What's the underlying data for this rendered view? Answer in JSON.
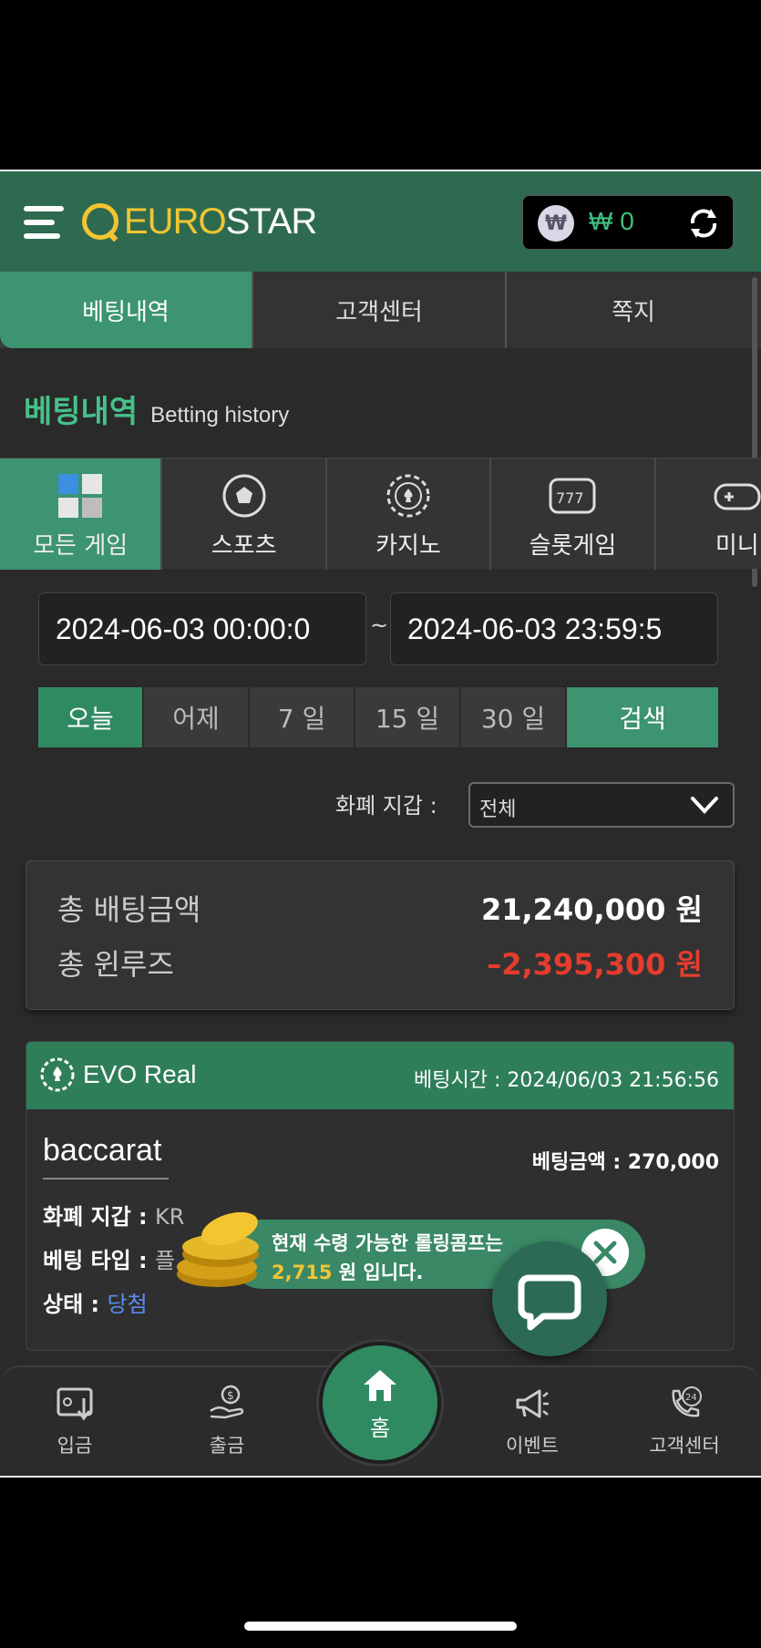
{
  "header": {
    "logo_euro": "EURO",
    "logo_star": "STAR",
    "won_symbol": "₩",
    "wallet_amount": "₩ 0"
  },
  "top_tabs": [
    {
      "label": "베팅내역",
      "active": true
    },
    {
      "label": "고객센터",
      "active": false
    },
    {
      "label": "쪽지",
      "active": false
    }
  ],
  "section": {
    "title_ko": "베팅내역",
    "title_en": "Betting history"
  },
  "categories": [
    {
      "label": "모든 게임",
      "icon": "all-games-icon",
      "active": true
    },
    {
      "label": "스포츠",
      "icon": "soccer-ball-icon",
      "active": false
    },
    {
      "label": "카지노",
      "icon": "casino-chip-icon",
      "active": false
    },
    {
      "label": "슬롯게임",
      "icon": "slot-machine-icon",
      "active": false
    },
    {
      "label": "미니",
      "icon": "gamepad-icon",
      "active": false
    }
  ],
  "filter": {
    "date_from": "2024-06-03 00:00:0",
    "date_to": "2024-06-03 23:59:5",
    "tilde": "~",
    "ranges": [
      "오늘",
      "어제",
      "7 일",
      "15 일",
      "30 일"
    ],
    "active_range": "오늘",
    "search_label": "검색",
    "currency_label": "화폐 지갑 :",
    "currency_value": "전체"
  },
  "summary": {
    "total_bet_label": "총 배팅금액",
    "total_bet_value": "21,240,000 원",
    "total_winloss_label": "총 윈루즈",
    "total_winloss_value": "–2,395,300 원"
  },
  "bet_card": {
    "game": "EVO Real",
    "bet_time": "베팅시간 : 2024/06/03 21:56:56",
    "title": "baccarat",
    "amount": "베팅금액 : 270,000",
    "currency_label": "화폐 지갑 :",
    "currency_value": "KR",
    "type_label": "베팅 타입 :",
    "type_value": "플",
    "status_label": "상태 :",
    "status_value": "당첨"
  },
  "toast": {
    "line1": "현재 수령 가능한 롤링콤프는",
    "amount": "2,715",
    "line2_suffix": "원 입니다."
  },
  "bottom_nav": [
    {
      "label": "입금",
      "icon": "deposit-icon"
    },
    {
      "label": "출금",
      "icon": "withdraw-icon"
    },
    {
      "label": "홈",
      "icon": "home-icon"
    },
    {
      "label": "이벤트",
      "icon": "megaphone-icon"
    },
    {
      "label": "고객센터",
      "icon": "support-24-icon"
    }
  ],
  "colors": {
    "brand_green": "#2e6a4f",
    "accent_green": "#3d9470",
    "logo_yellow": "#f2c531",
    "negative_red": "#e53c2e",
    "status_blue": "#5a8cf0"
  }
}
